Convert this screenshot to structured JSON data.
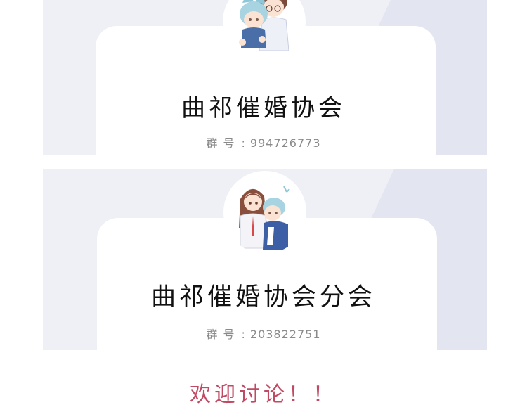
{
  "groups": [
    {
      "name": "曲祁催婚协会",
      "id_label": "群号",
      "id_sep": ":",
      "id_number": "994726773"
    },
    {
      "name": "曲祁催婚协会分会",
      "id_label": "群号",
      "id_sep": ":",
      "id_number": "203822751"
    }
  ],
  "footer": {
    "message": "欢迎讨论！！"
  },
  "colors": {
    "panel_bg": "#eef0f6",
    "footer_text": "#c04a63",
    "id_text": "#8a8a8a"
  }
}
